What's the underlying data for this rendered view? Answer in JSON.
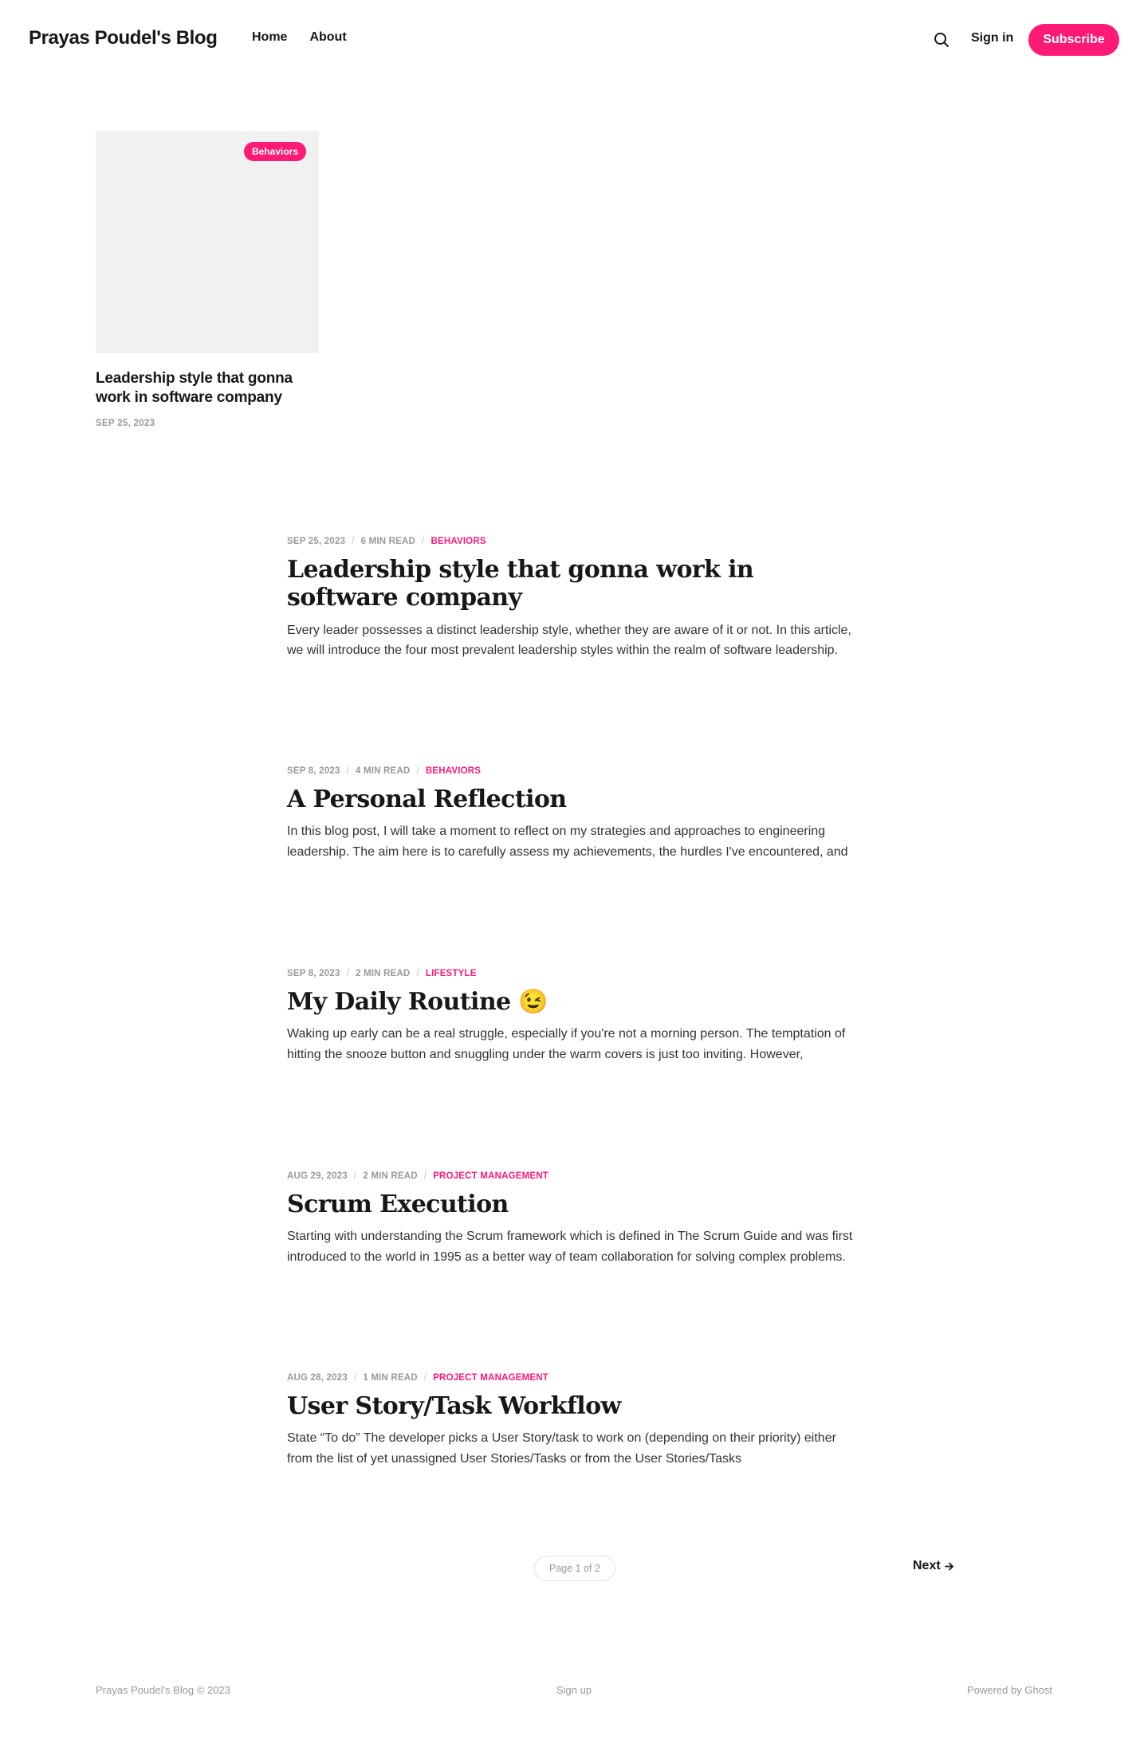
{
  "header": {
    "site_title": "Prayas Poudel's Blog",
    "nav": [
      {
        "label": "Home"
      },
      {
        "label": "About"
      }
    ],
    "search_icon": "search-icon",
    "signin_label": "Sign in",
    "subscribe_label": "Subscribe",
    "accent_color": "#ff1a75"
  },
  "featured": {
    "tag": "Behaviors",
    "title": "Leadership style that gonna work in software company",
    "date": "SEP 25, 2023"
  },
  "posts": [
    {
      "date": "SEP 25, 2023",
      "read_time": "6 MIN READ",
      "tag": "BEHAVIORS",
      "title": "Leadership style that gonna work in software company",
      "excerpt": "Every leader possesses a distinct leadership style, whether they are aware of it or not. In this article, we will introduce the four most prevalent leadership styles within the realm of software leadership."
    },
    {
      "date": "SEP 8, 2023",
      "read_time": "4 MIN READ",
      "tag": "BEHAVIORS",
      "title": "A Personal Reflection",
      "excerpt": "In this blog post, I will take a moment to reflect on my strategies and approaches to engineering leadership. The aim here is to carefully assess my achievements, the hurdles I've encountered, and"
    },
    {
      "date": "SEP 8, 2023",
      "read_time": "2 MIN READ",
      "tag": "LIFESTYLE",
      "title": "My Daily Routine 😉",
      "excerpt": "Waking up early can be a real struggle, especially if you're not a morning person. The temptation of hitting the snooze button and snuggling under the warm covers is just too inviting. However,"
    },
    {
      "date": "AUG 29, 2023",
      "read_time": "2 MIN READ",
      "tag": "PROJECT MANAGEMENT",
      "title": "Scrum Execution",
      "excerpt": "Starting with understanding the Scrum framework which is defined in The Scrum Guide and was first introduced to the world in 1995 as a better way of team collaboration for solving complex problems."
    },
    {
      "date": "AUG 28, 2023",
      "read_time": "1 MIN READ",
      "tag": "PROJECT MANAGEMENT",
      "title": "User Story/Task Workflow",
      "excerpt": "State “To do” The developer picks a User Story/task to work on (depending on their priority) either from the list of yet unassigned User Stories/Tasks or from the User Stories/Tasks"
    }
  ],
  "pagination": {
    "page_label": "Page 1 of 2",
    "next_label": "Next",
    "next_icon": "arrow-right-icon"
  },
  "footer": {
    "copyright": "Prayas Poudel's Blog © 2023",
    "signup": "Sign up",
    "powered": "Powered by Ghost"
  }
}
